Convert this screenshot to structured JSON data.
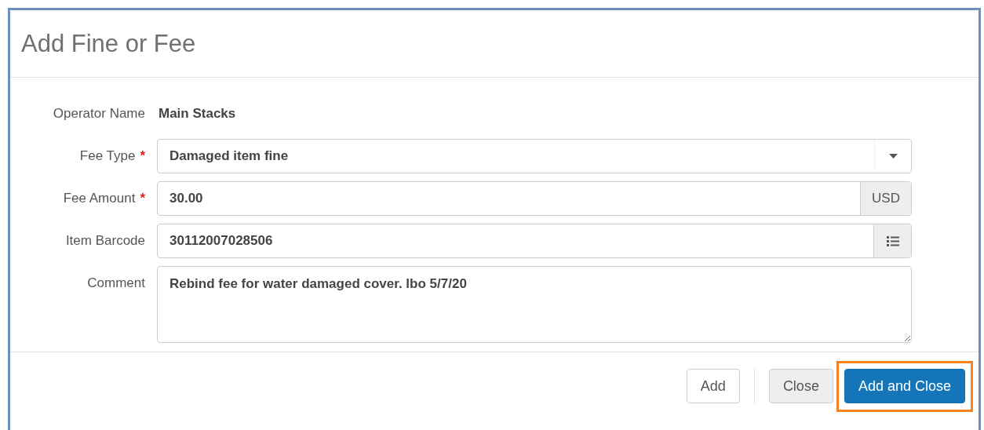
{
  "dialog": {
    "title": "Add Fine or Fee"
  },
  "fields": [
    {
      "kind": "static",
      "label": "Operator Name",
      "value": "Main Stacks"
    },
    {
      "kind": "select",
      "label": "Fee Type",
      "required_mark": "*",
      "value": "Damaged item fine"
    },
    {
      "kind": "addon",
      "label": "Fee Amount",
      "required_mark": "*",
      "value": "30.00",
      "addon": "USD"
    },
    {
      "kind": "picker",
      "label": "Item Barcode",
      "value": "30112007028506"
    },
    {
      "kind": "textarea",
      "label": "Comment",
      "value": "Rebind fee for water damaged cover. lbo 5/7/20"
    }
  ],
  "buttons": [
    {
      "label": "Add",
      "kind": "default",
      "highlighted": false
    },
    {
      "label": "Close",
      "kind": "secondary",
      "highlighted": false
    },
    {
      "label": "Add and Close",
      "kind": "primary",
      "highlighted": true
    }
  ]
}
